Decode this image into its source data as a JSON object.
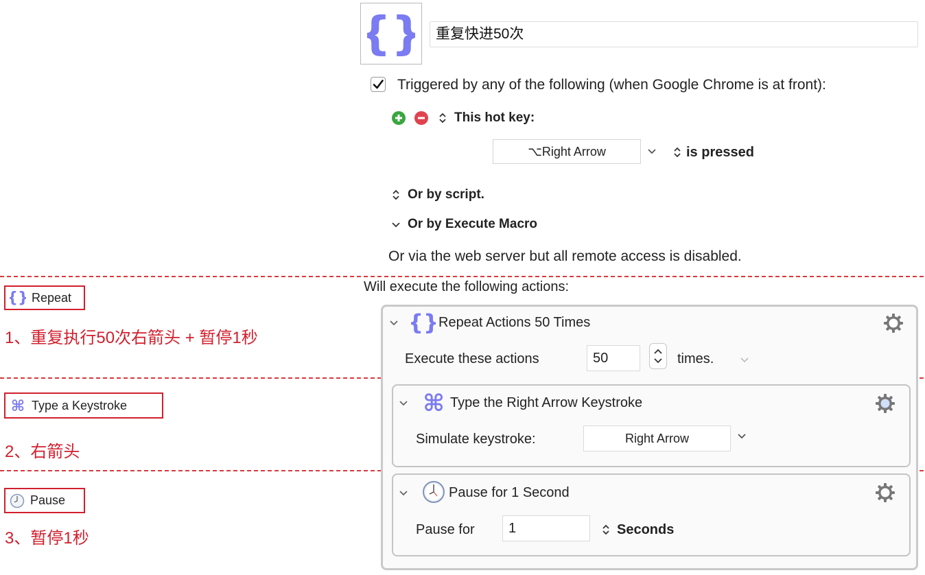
{
  "macro": {
    "name": "重复快进50次",
    "icon": "curly-braces-icon"
  },
  "trigger": {
    "checkbox_checked": true,
    "heading": "Triggered by any of the following (when Google Chrome is at front):",
    "hotkey_label": "This hot key:",
    "hotkey_value": "⌥Right Arrow",
    "hotkey_condition": "is pressed",
    "or_script": "Or by script.",
    "or_execute_macro": "Or by Execute Macro",
    "web_server_note": "Or via the web server but all remote access is disabled."
  },
  "actions_heading": "Will execute the following actions:",
  "annotations": [
    {
      "badge": "Repeat",
      "icon": "curly-braces-icon",
      "note": "1、重复执行50次右箭头 + 暂停1秒"
    },
    {
      "badge": "Type a Keystroke",
      "icon": "command-key-icon",
      "note": "2、右箭头"
    },
    {
      "badge": "Pause",
      "icon": "clock-icon",
      "note": "3、暂停1秒"
    }
  ],
  "repeat_action": {
    "title": "Repeat Actions 50 Times",
    "execute_label": "Execute these actions",
    "count": "50",
    "times_label": "times."
  },
  "keystroke_action": {
    "title": "Type the Right Arrow Keystroke",
    "simulate_label": "Simulate keystroke:",
    "keystroke_value": "Right Arrow"
  },
  "pause_action": {
    "title": "Pause for 1 Second",
    "pause_label": "Pause for",
    "duration": "1",
    "unit": "Seconds"
  },
  "colors": {
    "icon_purple": "#7b7bf2",
    "annotation_red": "#d11f2d",
    "add_green": "#3aa640",
    "remove_red": "#e0434e"
  }
}
